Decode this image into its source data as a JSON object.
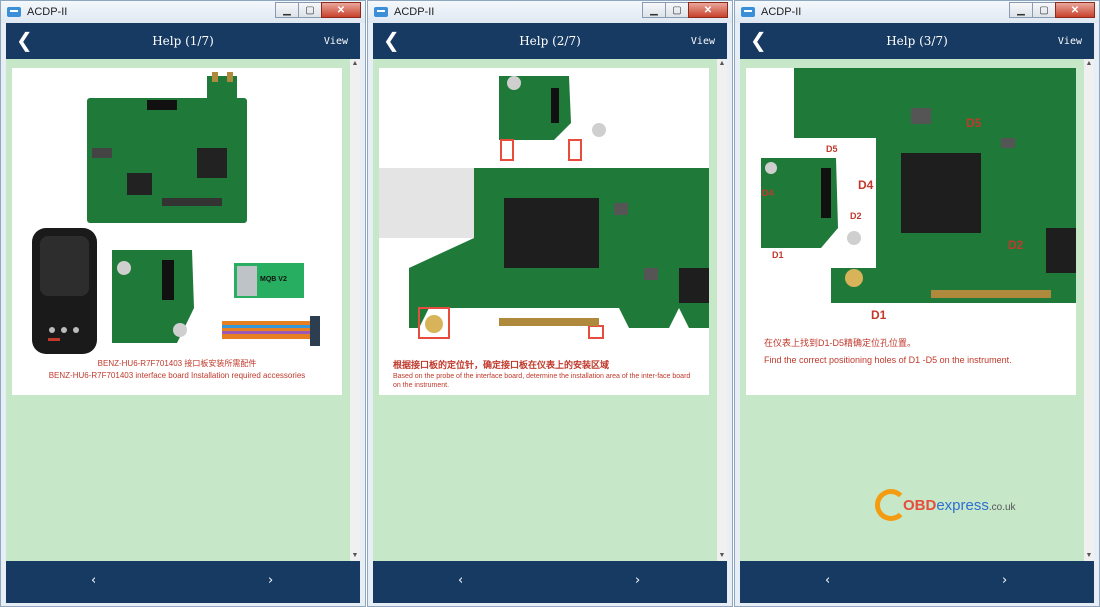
{
  "app_title": "ACDP-II",
  "header": {
    "back_glyph": "❮",
    "view_label": "View"
  },
  "footer": {
    "prev_glyph": "‹",
    "next_glyph": "›"
  },
  "pages": [
    {
      "title": "Help (1/7)",
      "caption_cn": "BENZ-HU6-R7F701403 接口板安装所需配件",
      "caption_en": "BENZ-HU6-R7F701403 interface board Installation required accessories",
      "board_label": "MQB V2"
    },
    {
      "title": "Help (2/7)",
      "caption_cn": "根据接口板的定位针，确定接口板在仪表上的安装区域",
      "caption_en": "Based on the probe of the interface board, determine the installation area of the inter-face board on the instrument."
    },
    {
      "title": "Help (3/7)",
      "caption_cn": "在仪表上找到D1-D5精确定位孔位置。",
      "caption_en": "Find the correct positioning holes of D1 -D5 on the instrument.",
      "labels": [
        "D5",
        "D4",
        "D2",
        "D1",
        "D5",
        "D4",
        "D2",
        "D1"
      ]
    }
  ],
  "watermark": {
    "brand_prefix": "OBD",
    "brand_rest": "express",
    "tld": ".co.uk"
  },
  "icons": [
    "app-icon",
    "minimize-icon",
    "maximize-icon",
    "close-icon",
    "back-arrow-icon",
    "scroll-up-arrow-icon",
    "scroll-down-arrow-icon",
    "prev-page-icon",
    "next-page-icon"
  ],
  "colors": {
    "header_bg": "#173a63",
    "content_bg": "#c7e7c9",
    "caption_red": "#c0392b",
    "pcb_green": "#1f7a3a"
  }
}
